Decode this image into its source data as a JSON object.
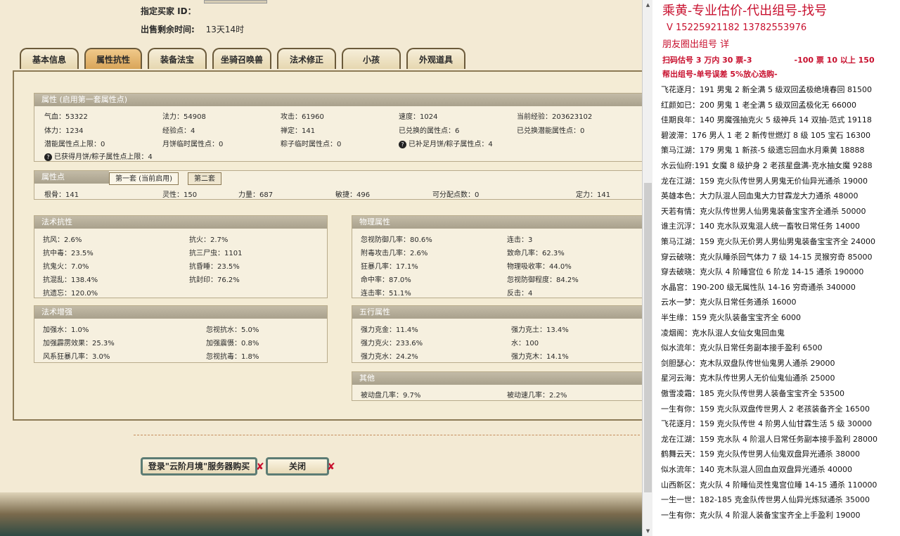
{
  "header": {
    "buyer_label": "指定买家 ID：",
    "time_label": "出售剩余时间:",
    "time_value": "13天14时"
  },
  "tabs": [
    "基本信息",
    "属性抗性",
    "装备法宝",
    "坐骑召唤兽",
    "法术修正",
    "小孩",
    "外观道具"
  ],
  "attributes": {
    "title": "属性 (启用第一套属性点)",
    "rows": [
      [
        "气血：53322",
        "法力：54908",
        "攻击：61960",
        "速度：1024",
        "当前经验：203623102"
      ],
      [
        "体力：1234",
        "经验点：4",
        "禅定：141",
        "已兑换的属性点：6",
        "已兑换潜能属性点：0"
      ],
      [
        "潜能属性点上限：0",
        "月饼临时属性点：0",
        "粽子临时属性点：0",
        "已补足月饼/粽子属性点：4",
        ""
      ]
    ],
    "footnote": "已获得月饼/粽子属性点上限：4"
  },
  "points": {
    "title": "属性点",
    "tab1": "第一套 (当前启用)",
    "tab2": "第二套",
    "cells": [
      "根骨：141",
      "灵性：150",
      "力量：687",
      "敏捷：496",
      "可分配点数：0",
      "定力：141"
    ]
  },
  "magic_resist": {
    "title": "法术抗性",
    "cells": [
      "抗风：2.6%",
      "抗火：2.7%",
      "抗中毒：23.5%",
      "抗三尸虫：1101",
      "抗鬼火：7.0%",
      "抗昏睡：23.5%",
      "抗混乱：138.4%",
      "抗封印：76.2%",
      "抗遗忘：120.0%"
    ]
  },
  "physical": {
    "title": "物理属性",
    "cells": [
      "忽视防御几率：80.6%",
      "连击：3",
      "附毒攻击几率：2.6%",
      "致命几率：62.3%",
      "狂暴几率：17.1%",
      "物理吸收率：44.0%",
      "命中率：87.0%",
      "忽视防御程度：84.2%",
      "连击率：51.1%",
      "反击：4"
    ]
  },
  "magic_boost": {
    "title": "法术增强",
    "cells": [
      "加强水：1.0%",
      "忽视抗水：5.0%",
      "加强霹雳效果：25.3%",
      "加强震慑：0.8%",
      "风系狂暴几率：3.0%",
      "忽视抗毒：1.8%"
    ]
  },
  "five_elements": {
    "title": "五行属性",
    "cells": [
      "强力克金：11.4%",
      "强力克土：13.4%",
      "强力克火：233.6%",
      "水：100",
      "强力克水：24.2%",
      "强力克木：14.1%"
    ]
  },
  "other": {
    "title": "其他",
    "cells": [
      "被动盘几率：9.7%",
      "被动速几率：2.2%"
    ]
  },
  "buttons": {
    "login": "登录\"云阶月境\"服务器购买",
    "close": "关闭"
  },
  "ad": {
    "title": "乘黄-专业估价-代出组号-找号",
    "phones": "V 15225921182   13782553976",
    "circle": "朋友圈出组号    详",
    "scan": "扫码估号 3 万内 30 票-3",
    "scan_tail": "-100 票  10 以上 150",
    "help": "帮出组号-单号误差 5%放心选购-",
    "listings": [
      "飞花逐月：191 男鬼 2 新全满 5 级双回孟极绝境春回 81500",
      "红颜如已：200 男鬼 1 老全满 5 级双回孟极化无 66000",
      "佳期良年：140 男魔强抽克火 5 级神兵 14 双抽-范式 19118",
      "碧波滞：176 男人 1 老 2 新传世燃灯 8 级 105 宝石 16300",
      "策马江湖：179 男鬼 1 新孩-5 级遗忘回血水月乘黄 18888",
      "水云仙府:191 女魔 8 级护身 2 老孩星盘满-克水抽女魔 9288",
      "龙在江湖：159 克火队传世男人男鬼无价仙异光通杀 19000",
      "英雄本色：大力队混人回血鬼大力甘霖龙大力通杀 48000",
      "天若有情：克火队传世男人仙男鬼装备宝宝齐全通杀 50000",
      "谁主沉浮：140 克水队双鬼混人统一畜牧日常任务 14000",
      "策马江湖：159 克火队无价男人男仙男鬼装备宝宝齐全 24000",
      "穿云破晓：克火队睡杀回气体力 7 级 14-15 灵猴穷奇 85000",
      "穿去破晓：克火队 4 阶睡宫位 6 阶龙 14-15 通杀 190000",
      "水晶宫：190-200 级无属性队 14-16 穷奇通杀 340000",
      "云水一梦：克火队日常任务通杀 16000",
      "半生缘：159 克火队装备宝宝齐全 6000",
      "凌烟阁：克水队混人女仙女鬼回血鬼",
      "似水流年：克火队日常任务副本接手盈利 6500",
      "剑胆瑟心：克木队双盘队传世仙鬼男人通杀 29000",
      "星河云海：克木队传世男人无价仙鬼仙通杀 25000",
      "傲雪凌霜：185 克火队传世男人装备宝宝齐全 53500",
      "一生有你：159 克火队双盘传世男人 2 老孩装备齐全 16500",
      "飞花逐月：159 克火队传世 4 阶男人仙甘霖生活 5 级 30000",
      "龙在江湖：159 克水队 4 阶混人日常任务副本接手盈利 28000",
      "鹤舞云天：159 克火队传世男人仙鬼双盘异光通杀 38000",
      "似水流年：140 克木队混人回血血双盘异光通杀 40000",
      "山西新区：克火队 4 阶睡仙灵性鬼宫位睡 14-15 通杀 110000",
      "一生一世：182-185 克金队传世男人仙异光炼狱通杀 35000",
      "一生有你：克火队 4 阶混人装备宝宝齐全上手盈利 19000"
    ]
  }
}
